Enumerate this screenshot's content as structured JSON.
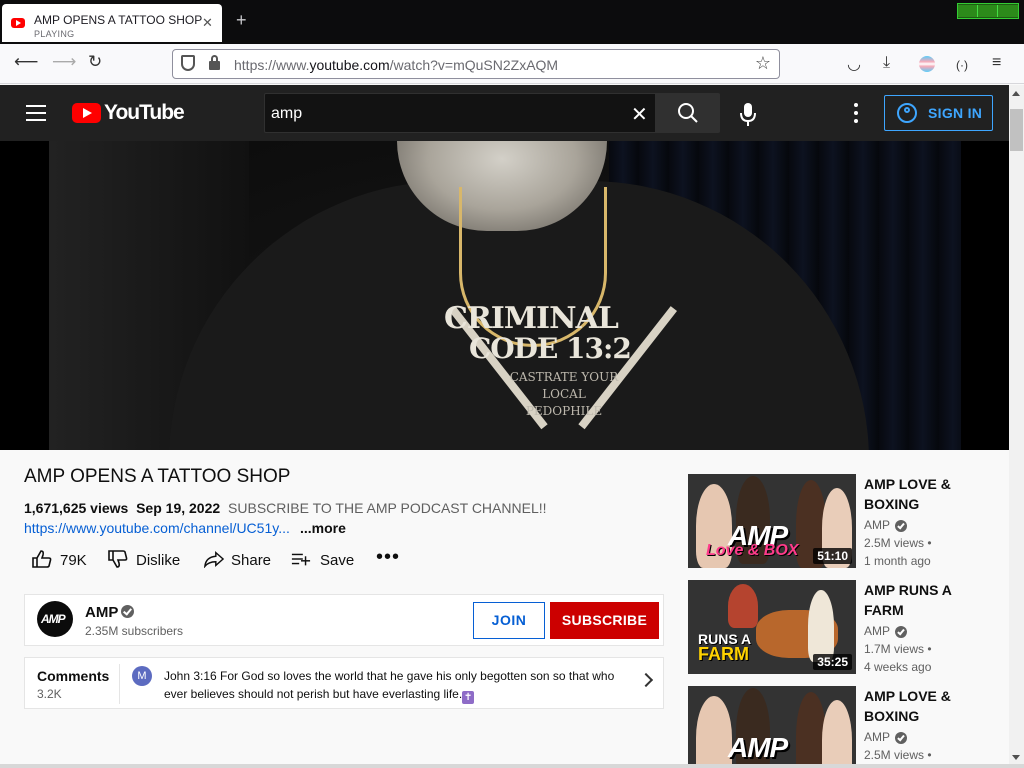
{
  "browser": {
    "tab": {
      "title": "AMP OPENS A TATTOO SHOP",
      "subtitle": "PLAYING"
    },
    "new_tab": "+",
    "url": {
      "prefix": "https://www.",
      "domain": "youtube.com",
      "path": "/watch?v=mQuSN2ZxAQM"
    }
  },
  "header": {
    "logo_text": "YouTube",
    "search": {
      "value": "amp",
      "placeholder": "Search"
    },
    "sign_in": "SIGN IN"
  },
  "video": {
    "frame_text": {
      "line1": "CRIMINAL",
      "line2": "CODE 13:2",
      "line3": "CASTRATE YOUR LOCAL PEDOPHILE"
    },
    "title": "AMP OPENS A TATTOO SHOP",
    "views": "1,671,625 views",
    "date": "Sep 19, 2022",
    "description": "SUBSCRIBE TO THE AMP PODCAST CHANNEL!!",
    "link": "https://www.youtube.com/channel/UC51y...",
    "more": "...more"
  },
  "actions": {
    "likes": "79K",
    "dislike": "Dislike",
    "share": "Share",
    "save": "Save"
  },
  "channel": {
    "avatar_text": "AMP",
    "name": "AMP",
    "subscribers": "2.35M subscribers",
    "join": "JOIN",
    "subscribe": "SUBSCRIBE"
  },
  "comments": {
    "title": "Comments",
    "count": "3.2K",
    "avatar_letter": "M",
    "top_comment": "John 3:16 For God so loves the world that he gave his only begotten son so that who ever believes should not perish but have everlasting life."
  },
  "related": [
    {
      "title": "AMP LOVE & BOXING",
      "channel": "AMP",
      "views": "2.5M views •",
      "age": "1 month ago",
      "duration": "51:10",
      "thumb_word": "AMP",
      "thumb_sub": "Love & BOX"
    },
    {
      "title": "AMP RUNS A FARM",
      "channel": "AMP",
      "views": "1.7M views •",
      "age": "4 weeks ago",
      "duration": "35:25",
      "thumb_word": "RUNS A",
      "thumb_sub": "FARM"
    },
    {
      "title": "AMP LOVE & BOXING",
      "channel": "AMP",
      "views": "2.5M views •",
      "age": "",
      "duration": "",
      "thumb_word": "AMP",
      "thumb_sub": ""
    }
  ],
  "colors": {
    "yt_red": "#ff0000",
    "header_bg": "#212121",
    "link_blue": "#065fd4",
    "signin_blue": "#3ea6ff",
    "subscribe_red": "#cc0000"
  }
}
